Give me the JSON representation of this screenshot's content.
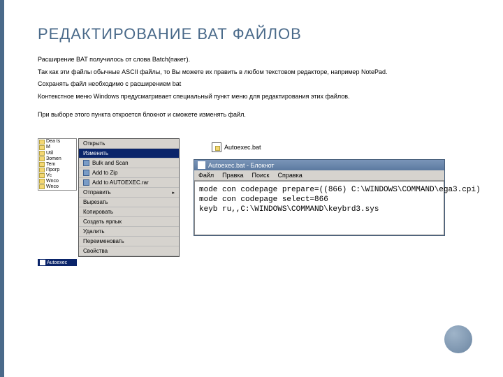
{
  "title": "РЕДАКТИРОВАНИЕ ВАТ ФАЙЛОВ",
  "paragraphs": {
    "p1": "Расширение BAT получилось от слова Batch(пакет).",
    "p2": "Так как эти файлы обычные ASCII файлы, то Вы можете их править в любом текстовом редакторе, например NotePad.",
    "p3": "Сохранять файл необходимо с расширением bat",
    "p4": "Контекстное меню Windows предусматривает специальный пункт меню для редактирования этих файлов.",
    "p5": "При выборе этого пункта откроется блокнот и сможете изменять файл."
  },
  "folder_list": [
    "Dea ts",
    "M",
    "Util",
    "Зomen",
    "Tem",
    "Прогр",
    "Vc",
    "Wnco",
    "Wnco"
  ],
  "selected_file_label": "Autoexec",
  "context_menu": {
    "open": "Открыть",
    "edit": "Изменить",
    "bulk": "Bulk and Scan",
    "addzip": "Add to Zip",
    "addarc": "Add to AUTOEXEC.rar",
    "sendto": "Отправить",
    "cut": "Вырезать",
    "copy": "Копировать",
    "shortcut": "Создать ярлык",
    "delete": "Удалить",
    "rename": "Переименовать",
    "props": "Свойства"
  },
  "desktop_icon_label": "Autoexec.bat",
  "notepad": {
    "title": "Autoexec.bat - Блокнот",
    "menu": {
      "file": "Файл",
      "edit": "Правка",
      "search": "Поиск",
      "help": "Справка"
    },
    "body": "mode con codepage prepare=((866) C:\\WINDOWS\\COMMAND\\ega3.cpi)\nmode con codepage select=866\nkeyb ru,,C:\\WINDOWS\\COMMAND\\keybrd3.sys"
  }
}
